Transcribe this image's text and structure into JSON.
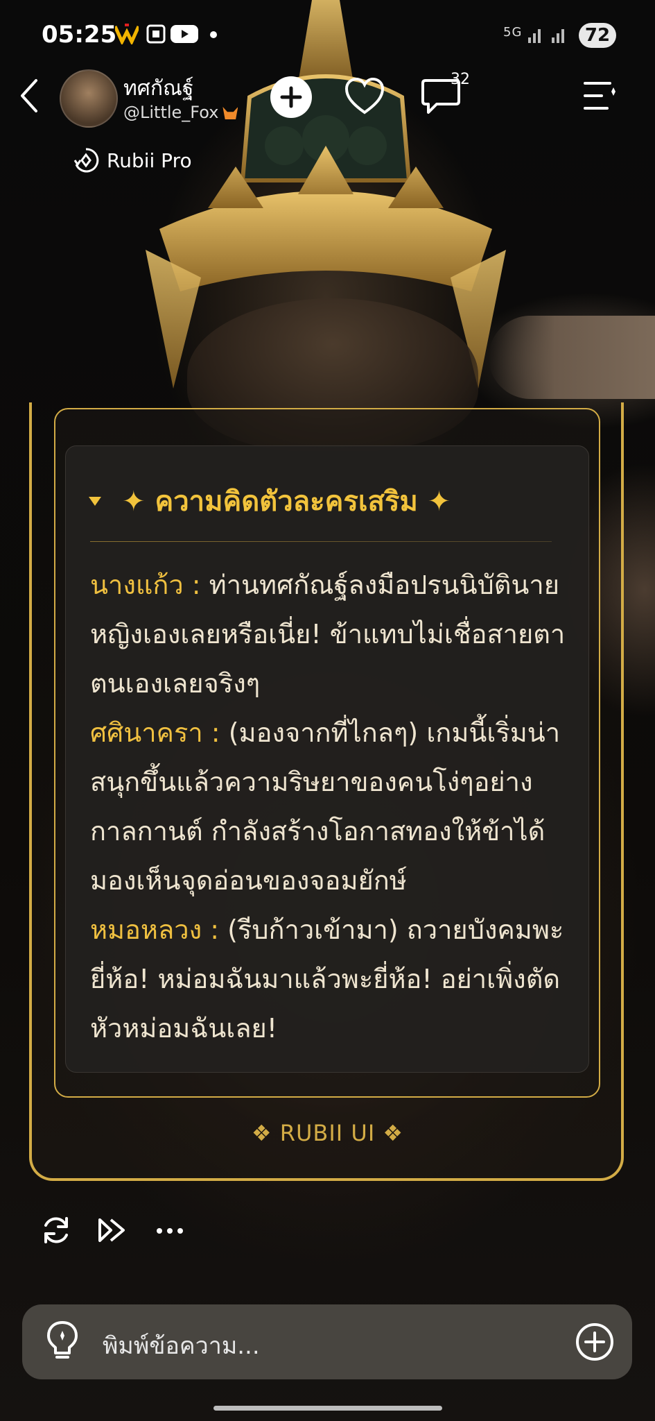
{
  "status_bar": {
    "time": "05:25",
    "network": "5G",
    "battery": "72"
  },
  "header": {
    "character_name": "ทศกัณฐ์",
    "creator_handle": "@Little_Fox",
    "comment_count": "32",
    "pro_label": "Rubii Pro"
  },
  "card": {
    "title": "✦ ความคิดตัวละครเสริม ✦",
    "dialogue": [
      {
        "speaker": "นางแก้ว :",
        "text": " ท่านทศกัณฐ์ลงมือปรนนิบัตินายหญิงเองเลยหรือเนี่ย! ข้าแทบไม่เชื่อสายตาตนเองเลยจริงๆ"
      },
      {
        "speaker": "ศศินาครา :",
        "text": " (มองจากที่ไกลๆ) เกมนี้เริ่มน่าสนุกขึ้นแล้วความริษยาของคนโง่ๆอย่างกาลกานต์ กำลังสร้างโอกาสทองให้ข้าได้มองเห็นจุดอ่อนของจอมยักษ์"
      },
      {
        "speaker": "หมอหลวง :",
        "text": " (รีบก้าวเข้ามา) ถวายบังคมพะยี่ห้อ! หม่อมฉันมาแล้วพะยี่ห้อ! อย่าเพิ่งตัดหัวหม่อมฉันเลย!"
      }
    ],
    "brand": "❖ RUBII UI ❖"
  },
  "input": {
    "placeholder": "พิมพ์ข้อความ..."
  },
  "colors": {
    "gold": "#d3ac46",
    "title_gold": "#f2c33c",
    "speaker_gold": "#f0c040"
  }
}
